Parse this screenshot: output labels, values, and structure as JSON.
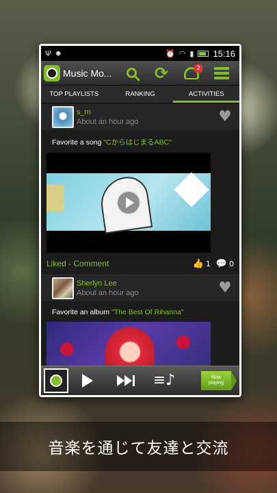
{
  "statusbar": {
    "time": "15:16",
    "notification_count": "2"
  },
  "app": {
    "title": "Music Mo..."
  },
  "tabs": [
    {
      "label": "TOP PLAYLISTS",
      "active": false
    },
    {
      "label": "RANKING",
      "active": false
    },
    {
      "label": "ACTIVITIES",
      "active": true
    }
  ],
  "feed": {
    "posts": [
      {
        "username": "s_m",
        "timestamp": "About an hour ago",
        "action_prefix": "Favorite a song ",
        "item_title": "\"CからはじまるABC\"",
        "media": "video",
        "liked_label": "Liked",
        "separator": " - ",
        "comment_label": "Comment",
        "likes": "1",
        "comments": "0"
      },
      {
        "username": "Sherlyn Lee",
        "timestamp": "About an hour ago",
        "action_prefix": "Favorite an album ",
        "item_title": "\"The Best Of Rihanna\"",
        "media": "album"
      }
    ]
  },
  "player": {
    "now_playing_line1": "Now",
    "now_playing_line2": "playing"
  },
  "caption": "音楽を通じて友達と交流",
  "colors": {
    "accent": "#84bd2a",
    "background": "#1c1c1c"
  },
  "icons": [
    "usb-icon",
    "bug-icon",
    "alarm-icon",
    "wifi-icon",
    "signal-icon",
    "battery-icon",
    "search-icon",
    "refresh-icon",
    "notification-icon",
    "menu-icon",
    "heart-broadcast-icon",
    "thumbs-up-icon",
    "comment-icon",
    "play-icon",
    "next-icon",
    "queue-icon"
  ]
}
